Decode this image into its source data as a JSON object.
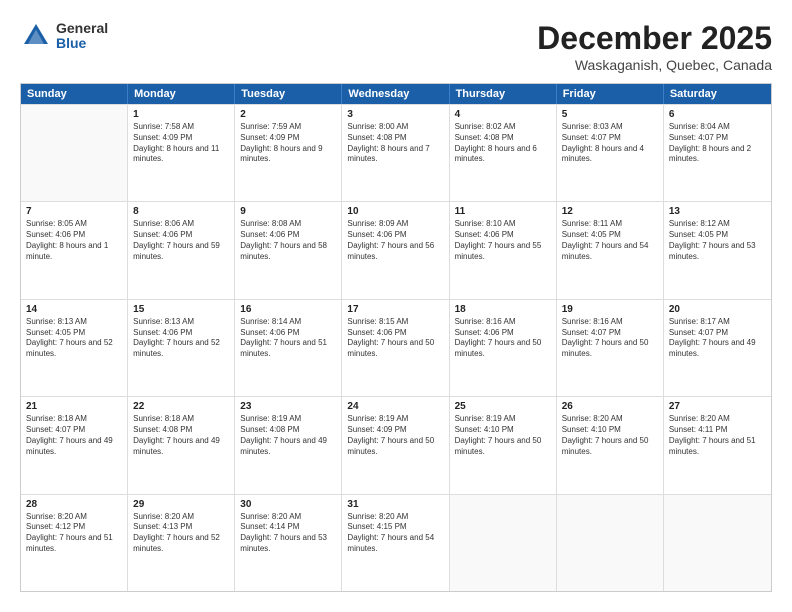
{
  "header": {
    "logo": {
      "general": "General",
      "blue": "Blue"
    },
    "title": "December 2025",
    "location": "Waskaganish, Quebec, Canada"
  },
  "days_of_week": [
    "Sunday",
    "Monday",
    "Tuesday",
    "Wednesday",
    "Thursday",
    "Friday",
    "Saturday"
  ],
  "weeks": [
    [
      {
        "day": "",
        "sunrise": "",
        "sunset": "",
        "daylight": ""
      },
      {
        "day": "1",
        "sunrise": "7:58 AM",
        "sunset": "4:09 PM",
        "daylight": "8 hours and 11 minutes."
      },
      {
        "day": "2",
        "sunrise": "7:59 AM",
        "sunset": "4:09 PM",
        "daylight": "8 hours and 9 minutes."
      },
      {
        "day": "3",
        "sunrise": "8:00 AM",
        "sunset": "4:08 PM",
        "daylight": "8 hours and 7 minutes."
      },
      {
        "day": "4",
        "sunrise": "8:02 AM",
        "sunset": "4:08 PM",
        "daylight": "8 hours and 6 minutes."
      },
      {
        "day": "5",
        "sunrise": "8:03 AM",
        "sunset": "4:07 PM",
        "daylight": "8 hours and 4 minutes."
      },
      {
        "day": "6",
        "sunrise": "8:04 AM",
        "sunset": "4:07 PM",
        "daylight": "8 hours and 2 minutes."
      }
    ],
    [
      {
        "day": "7",
        "sunrise": "8:05 AM",
        "sunset": "4:06 PM",
        "daylight": "8 hours and 1 minute."
      },
      {
        "day": "8",
        "sunrise": "8:06 AM",
        "sunset": "4:06 PM",
        "daylight": "7 hours and 59 minutes."
      },
      {
        "day": "9",
        "sunrise": "8:08 AM",
        "sunset": "4:06 PM",
        "daylight": "7 hours and 58 minutes."
      },
      {
        "day": "10",
        "sunrise": "8:09 AM",
        "sunset": "4:06 PM",
        "daylight": "7 hours and 56 minutes."
      },
      {
        "day": "11",
        "sunrise": "8:10 AM",
        "sunset": "4:06 PM",
        "daylight": "7 hours and 55 minutes."
      },
      {
        "day": "12",
        "sunrise": "8:11 AM",
        "sunset": "4:05 PM",
        "daylight": "7 hours and 54 minutes."
      },
      {
        "day": "13",
        "sunrise": "8:12 AM",
        "sunset": "4:05 PM",
        "daylight": "7 hours and 53 minutes."
      }
    ],
    [
      {
        "day": "14",
        "sunrise": "8:13 AM",
        "sunset": "4:05 PM",
        "daylight": "7 hours and 52 minutes."
      },
      {
        "day": "15",
        "sunrise": "8:13 AM",
        "sunset": "4:06 PM",
        "daylight": "7 hours and 52 minutes."
      },
      {
        "day": "16",
        "sunrise": "8:14 AM",
        "sunset": "4:06 PM",
        "daylight": "7 hours and 51 minutes."
      },
      {
        "day": "17",
        "sunrise": "8:15 AM",
        "sunset": "4:06 PM",
        "daylight": "7 hours and 50 minutes."
      },
      {
        "day": "18",
        "sunrise": "8:16 AM",
        "sunset": "4:06 PM",
        "daylight": "7 hours and 50 minutes."
      },
      {
        "day": "19",
        "sunrise": "8:16 AM",
        "sunset": "4:07 PM",
        "daylight": "7 hours and 50 minutes."
      },
      {
        "day": "20",
        "sunrise": "8:17 AM",
        "sunset": "4:07 PM",
        "daylight": "7 hours and 49 minutes."
      }
    ],
    [
      {
        "day": "21",
        "sunrise": "8:18 AM",
        "sunset": "4:07 PM",
        "daylight": "7 hours and 49 minutes."
      },
      {
        "day": "22",
        "sunrise": "8:18 AM",
        "sunset": "4:08 PM",
        "daylight": "7 hours and 49 minutes."
      },
      {
        "day": "23",
        "sunrise": "8:19 AM",
        "sunset": "4:08 PM",
        "daylight": "7 hours and 49 minutes."
      },
      {
        "day": "24",
        "sunrise": "8:19 AM",
        "sunset": "4:09 PM",
        "daylight": "7 hours and 50 minutes."
      },
      {
        "day": "25",
        "sunrise": "8:19 AM",
        "sunset": "4:10 PM",
        "daylight": "7 hours and 50 minutes."
      },
      {
        "day": "26",
        "sunrise": "8:20 AM",
        "sunset": "4:10 PM",
        "daylight": "7 hours and 50 minutes."
      },
      {
        "day": "27",
        "sunrise": "8:20 AM",
        "sunset": "4:11 PM",
        "daylight": "7 hours and 51 minutes."
      }
    ],
    [
      {
        "day": "28",
        "sunrise": "8:20 AM",
        "sunset": "4:12 PM",
        "daylight": "7 hours and 51 minutes."
      },
      {
        "day": "29",
        "sunrise": "8:20 AM",
        "sunset": "4:13 PM",
        "daylight": "7 hours and 52 minutes."
      },
      {
        "day": "30",
        "sunrise": "8:20 AM",
        "sunset": "4:14 PM",
        "daylight": "7 hours and 53 minutes."
      },
      {
        "day": "31",
        "sunrise": "8:20 AM",
        "sunset": "4:15 PM",
        "daylight": "7 hours and 54 minutes."
      },
      {
        "day": "",
        "sunrise": "",
        "sunset": "",
        "daylight": ""
      },
      {
        "day": "",
        "sunrise": "",
        "sunset": "",
        "daylight": ""
      },
      {
        "day": "",
        "sunrise": "",
        "sunset": "",
        "daylight": ""
      }
    ]
  ]
}
